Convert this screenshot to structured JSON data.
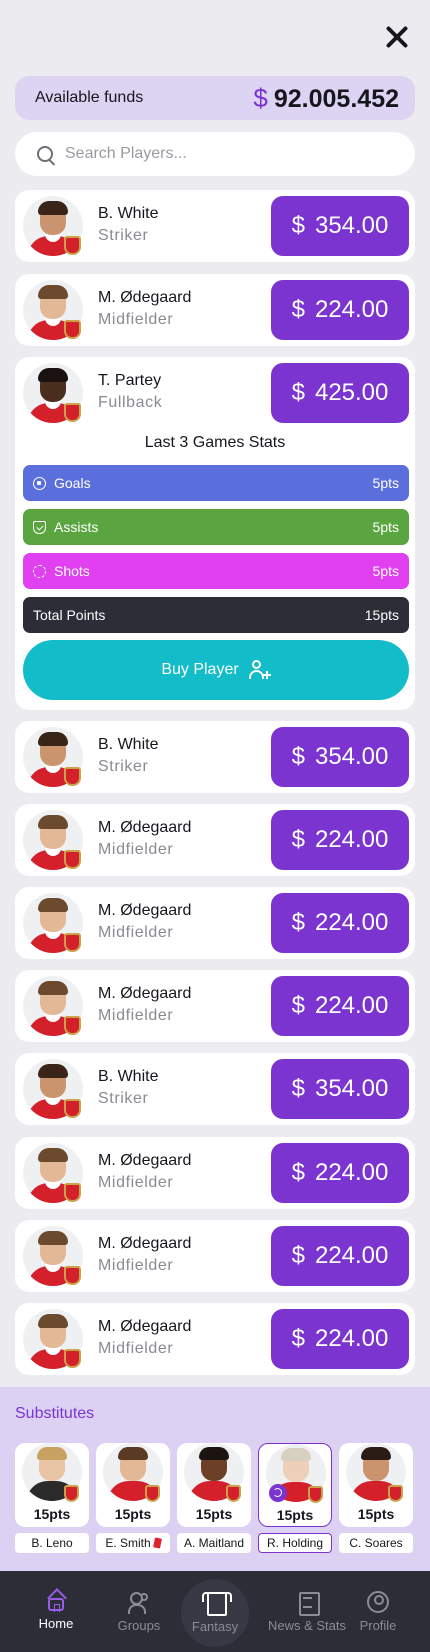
{
  "funds": {
    "label": "Available funds",
    "currency": "$",
    "amount": "92.005.452"
  },
  "search": {
    "placeholder": "Search Players...",
    "value": ""
  },
  "players": [
    {
      "name": "B. White",
      "position": "Striker",
      "currency": "$",
      "price": "354.00"
    },
    {
      "name": "M. Ødegaard",
      "position": "Midfielder",
      "currency": "$",
      "price": "224.00"
    },
    {
      "name": "T. Partey",
      "position": "Fullback",
      "currency": "$",
      "price": "425.00"
    },
    {
      "name": "B. White",
      "position": "Striker",
      "currency": "$",
      "price": "354.00"
    },
    {
      "name": "M. Ødegaard",
      "position": "Midfielder",
      "currency": "$",
      "price": "224.00"
    },
    {
      "name": "M. Ødegaard",
      "position": "Midfielder",
      "currency": "$",
      "price": "224.00"
    },
    {
      "name": "M. Ødegaard",
      "position": "Midfielder",
      "currency": "$",
      "price": "224.00"
    },
    {
      "name": "B. White",
      "position": "Striker",
      "currency": "$",
      "price": "354.00"
    },
    {
      "name": "M. Ødegaard",
      "position": "Midfielder",
      "currency": "$",
      "price": "224.00"
    },
    {
      "name": "M. Ødegaard",
      "position": "Midfielder",
      "currency": "$",
      "price": "224.00"
    },
    {
      "name": "M. Ødegaard",
      "position": "Midfielder",
      "currency": "$",
      "price": "224.00"
    }
  ],
  "expanded": {
    "stats_title": "Last 3 Games Stats",
    "stats": [
      {
        "label": "Goals",
        "value": "5pts",
        "icon": "football-icon",
        "color": "#5a6fdc"
      },
      {
        "label": "Assists",
        "value": "5pts",
        "icon": "assist-icon",
        "color": "#5aa53f"
      },
      {
        "label": "Shots",
        "value": "5pts",
        "icon": "target-icon",
        "color": "#e040f0"
      },
      {
        "label": "Total Points",
        "value": "15pts",
        "icon": "",
        "color": "#2c2d36"
      }
    ],
    "buy_label": "Buy Player"
  },
  "substitutes": {
    "title": "Substitutes",
    "items": [
      {
        "name": "B. Leno",
        "points": "15pts"
      },
      {
        "name": "E. Smith",
        "points": "15pts",
        "red_card": true
      },
      {
        "name": "A. Maitland",
        "points": "15pts"
      },
      {
        "name": "R. Holding",
        "points": "15pts",
        "selected": true
      },
      {
        "name": "C. Soares",
        "points": "15pts"
      }
    ]
  },
  "nav": [
    {
      "label": "Home",
      "icon": "home-icon",
      "active": true
    },
    {
      "label": "Groups",
      "icon": "groups-icon"
    },
    {
      "label": "Fantasy",
      "icon": "shirt-icon"
    },
    {
      "label": "News & Stats",
      "icon": "news-icon"
    },
    {
      "label": "Profile",
      "icon": "profile-icon"
    }
  ],
  "colors": {
    "accent": "#7b34d0",
    "buy": "#12bcc8",
    "nav_bg": "#2c2d36",
    "subs_bg": "#dcd1f3"
  }
}
